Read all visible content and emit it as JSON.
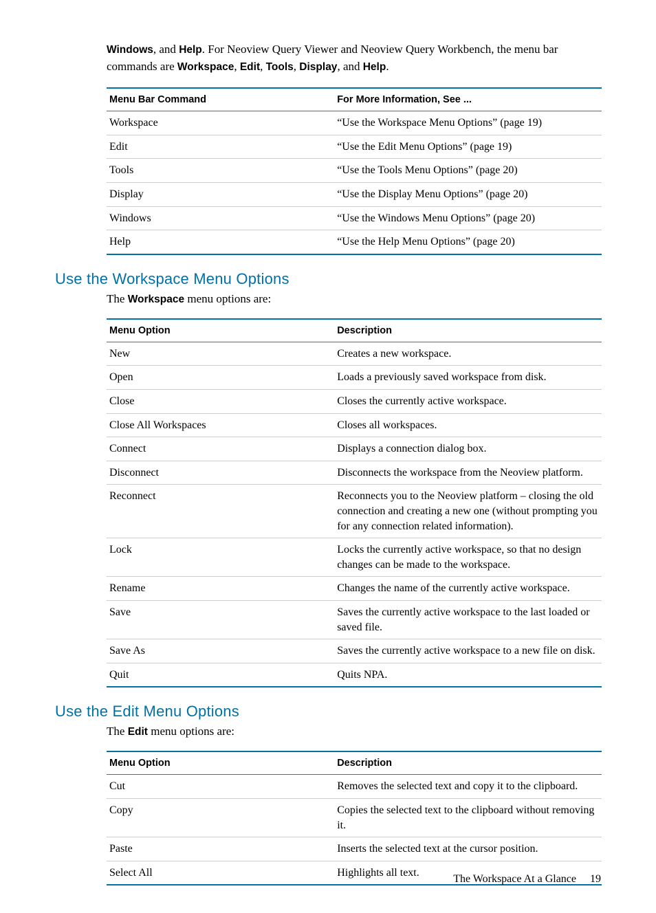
{
  "top_paragraph": {
    "pre_bold1": "",
    "bold1": "Windows",
    "mid1": ", and ",
    "bold2": "Help",
    "mid2": ". For Neoview Query Viewer and Neoview Query Workbench, the menu bar commands are ",
    "bold3": "Workspace",
    "sep2": ", ",
    "bold4": "Edit",
    "sep3": ", ",
    "bold5": "Tools",
    "sep4": ", ",
    "bold6": "Display",
    "sep5": ", and ",
    "bold7": "Help",
    "tail": "."
  },
  "table1": {
    "headers": {
      "col1": "Menu Bar Command",
      "col2": "For More Information, See ..."
    },
    "rows": [
      {
        "c1": "Workspace",
        "c2": "“Use the Workspace Menu Options” (page 19)"
      },
      {
        "c1": "Edit",
        "c2": "“Use the Edit Menu Options” (page 19)"
      },
      {
        "c1": "Tools",
        "c2": "“Use the Tools Menu Options” (page 20)"
      },
      {
        "c1": "Display",
        "c2": "“Use the Display Menu Options” (page 20)"
      },
      {
        "c1": "Windows",
        "c2": "“Use the Windows Menu Options” (page 20)"
      },
      {
        "c1": "Help",
        "c2": "“Use the Help Menu Options” (page 20)"
      }
    ]
  },
  "section_workspace": {
    "heading": "Use the Workspace Menu Options",
    "intro_pre": "The ",
    "intro_bold": "Workspace",
    "intro_post": " menu options are:",
    "table": {
      "headers": {
        "col1": "Menu Option",
        "col2": "Description"
      },
      "rows": [
        {
          "c1": "New",
          "c2": "Creates a new workspace."
        },
        {
          "c1": "Open",
          "c2": "Loads a previously saved workspace from disk."
        },
        {
          "c1": "Close",
          "c2": "Closes the currently active workspace."
        },
        {
          "c1": "Close All Workspaces",
          "c2": "Closes all workspaces."
        },
        {
          "c1": "Connect",
          "c2": "Displays a connection dialog box."
        },
        {
          "c1": "Disconnect",
          "c2": "Disconnects the workspace from the Neoview platform."
        },
        {
          "c1": "Reconnect",
          "c2": "Reconnects you to the Neoview platform – closing the old connection and creating a new one (without prompting you for any connection related information)."
        },
        {
          "c1": "Lock",
          "c2": "Locks the currently active workspace, so that no design changes can be made to the workspace."
        },
        {
          "c1": "Rename",
          "c2": "Changes the name of the currently active workspace."
        },
        {
          "c1": "Save",
          "c2": "Saves the currently active workspace to the last loaded or saved file."
        },
        {
          "c1": "Save As",
          "c2": "Saves the currently active workspace to a new file on disk."
        },
        {
          "c1": "Quit",
          "c2": "Quits NPA."
        }
      ]
    }
  },
  "section_edit": {
    "heading": "Use the Edit Menu Options",
    "intro_pre": "The ",
    "intro_bold": "Edit",
    "intro_post": " menu options are:",
    "table": {
      "headers": {
        "col1": "Menu Option",
        "col2": "Description"
      },
      "rows": [
        {
          "c1": "Cut",
          "c2": "Removes the selected text and copy it to the clipboard."
        },
        {
          "c1": "Copy",
          "c2": "Copies the selected text to the clipboard without removing it."
        },
        {
          "c1": "Paste",
          "c2": "Inserts the selected text at the cursor position."
        },
        {
          "c1": "Select All",
          "c2": "Highlights all text."
        }
      ]
    }
  },
  "footer": {
    "title": "The Workspace At a Glance",
    "page": "19"
  }
}
